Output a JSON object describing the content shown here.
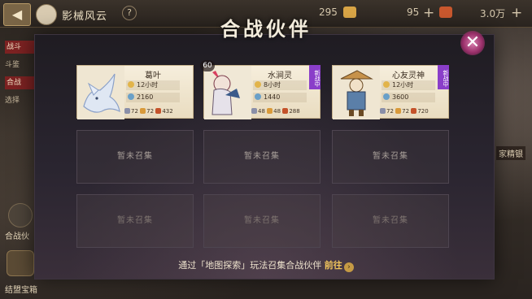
{
  "topbar": {
    "back_icon": "back-arrow-icon",
    "title": "影械风云",
    "help": "?",
    "res1_value": "295",
    "res2_value": "95",
    "res3_value": "3.0万",
    "plus": "+"
  },
  "left_menu": {
    "items": [
      "战斗",
      "斗鉴",
      "合战",
      "选择"
    ],
    "bottom_label": "合战伙",
    "bottom_label2": "结盟宝箱"
  },
  "right_tag": "家精银",
  "modal": {
    "title": "合战伙伴",
    "close": "✕",
    "cards": [
      {
        "name": "葛叶",
        "time": "12小时",
        "power": "2160",
        "res": [
          "72",
          "72",
          "432"
        ],
        "new_tag": null
      },
      {
        "name": "水涧灵",
        "time": "8小时",
        "power": "1440",
        "res": [
          "48",
          "48",
          "288"
        ],
        "new_tag": "新战中",
        "level": "60"
      },
      {
        "name": "心友灵神",
        "time": "12小时",
        "power": "3600",
        "res": [
          "72",
          "72",
          "720"
        ],
        "new_tag": "新战中"
      }
    ],
    "empty_label": "暂未召集",
    "footer_text": "通过「地图探索」玩法召集合战伙伴",
    "footer_go": "前往",
    "footer_arrow": "›"
  },
  "colors": {
    "accent_purple": "#8a3ec9",
    "go_gold": "#f0c45c",
    "card_bg": "#f6eedc"
  }
}
